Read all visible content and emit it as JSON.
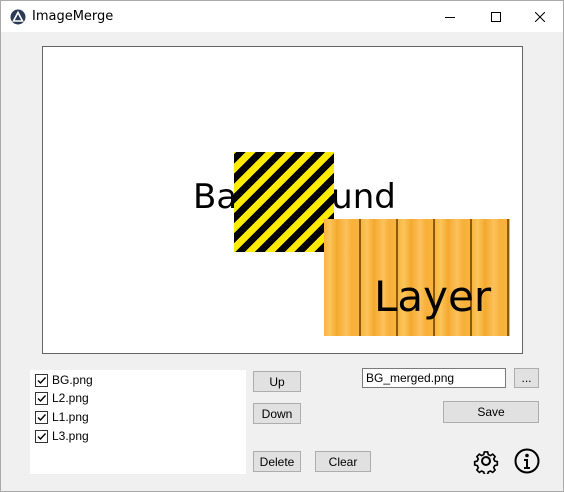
{
  "window": {
    "title": "ImageMerge"
  },
  "preview": {
    "background_text": "Background",
    "layer_text": "Layer"
  },
  "files": [
    {
      "name": "BG.png",
      "checked": true
    },
    {
      "name": "L2.png",
      "checked": true
    },
    {
      "name": "L1.png",
      "checked": true
    },
    {
      "name": "L3.png",
      "checked": true
    }
  ],
  "buttons": {
    "up": "Up",
    "down": "Down",
    "delete": "Delete",
    "clear": "Clear",
    "browse": "...",
    "save": "Save"
  },
  "output": {
    "filename": "BG_merged.png"
  },
  "icons": {
    "settings": "gear-icon",
    "info": "info-icon"
  }
}
